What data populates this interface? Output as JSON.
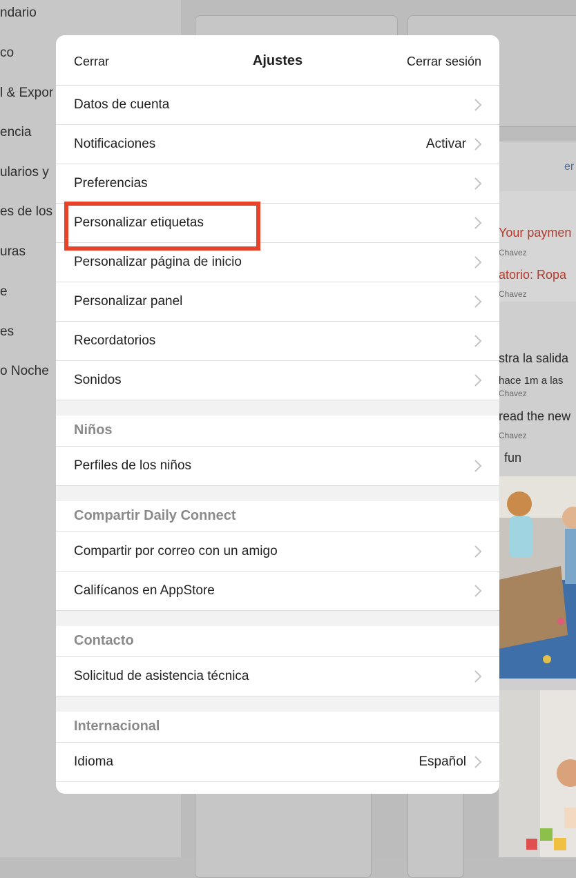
{
  "background": {
    "sidebar_items": [
      "ndario",
      "co",
      "l & Expor",
      "encia",
      "ularios y",
      "es de los",
      "uras",
      "e",
      "es",
      "o Noche"
    ],
    "feed": {
      "link": "er",
      "item1_title": "Your paymen",
      "item1_author": "Chavez",
      "item2_title": "atorio: Ropa",
      "item2_author": "Chavez",
      "item3_title": "stra la salida",
      "item3_time": "hace 1m a las",
      "item3_author": "Chavez",
      "item4_title": "read the new",
      "item4_author": "Chavez",
      "item5_title": "fun"
    }
  },
  "modal": {
    "title": "Ajustes",
    "close_label": "Cerrar",
    "logout_label": "Cerrar sesión",
    "rows": [
      {
        "label": "Datos de cuenta"
      },
      {
        "label": "Notificaciones",
        "value": "Activar"
      },
      {
        "label": "Preferencias"
      },
      {
        "label": "Personalizar etiquetas"
      },
      {
        "label": "Personalizar página de inicio"
      },
      {
        "label": "Personalizar panel"
      },
      {
        "label": "Recordatorios"
      },
      {
        "label": "Sonidos"
      }
    ],
    "sections": {
      "kids": {
        "header": "Niños",
        "rows": [
          {
            "label": "Perfiles de los niños"
          }
        ]
      },
      "share": {
        "header": "Compartir Daily Connect",
        "rows": [
          {
            "label": "Compartir por correo con un amigo"
          },
          {
            "label": "Califícanos en AppStore"
          }
        ]
      },
      "contact": {
        "header": "Contacto",
        "rows": [
          {
            "label": "Solicitud de asistencia técnica"
          }
        ]
      },
      "international": {
        "header": "Internacional",
        "rows": [
          {
            "label": "Idioma",
            "value": "Español"
          }
        ]
      }
    }
  },
  "colors": {
    "highlight": "#e8432a",
    "section_header_text": "#8a8a8a",
    "chevron": "#c4c4c4"
  }
}
